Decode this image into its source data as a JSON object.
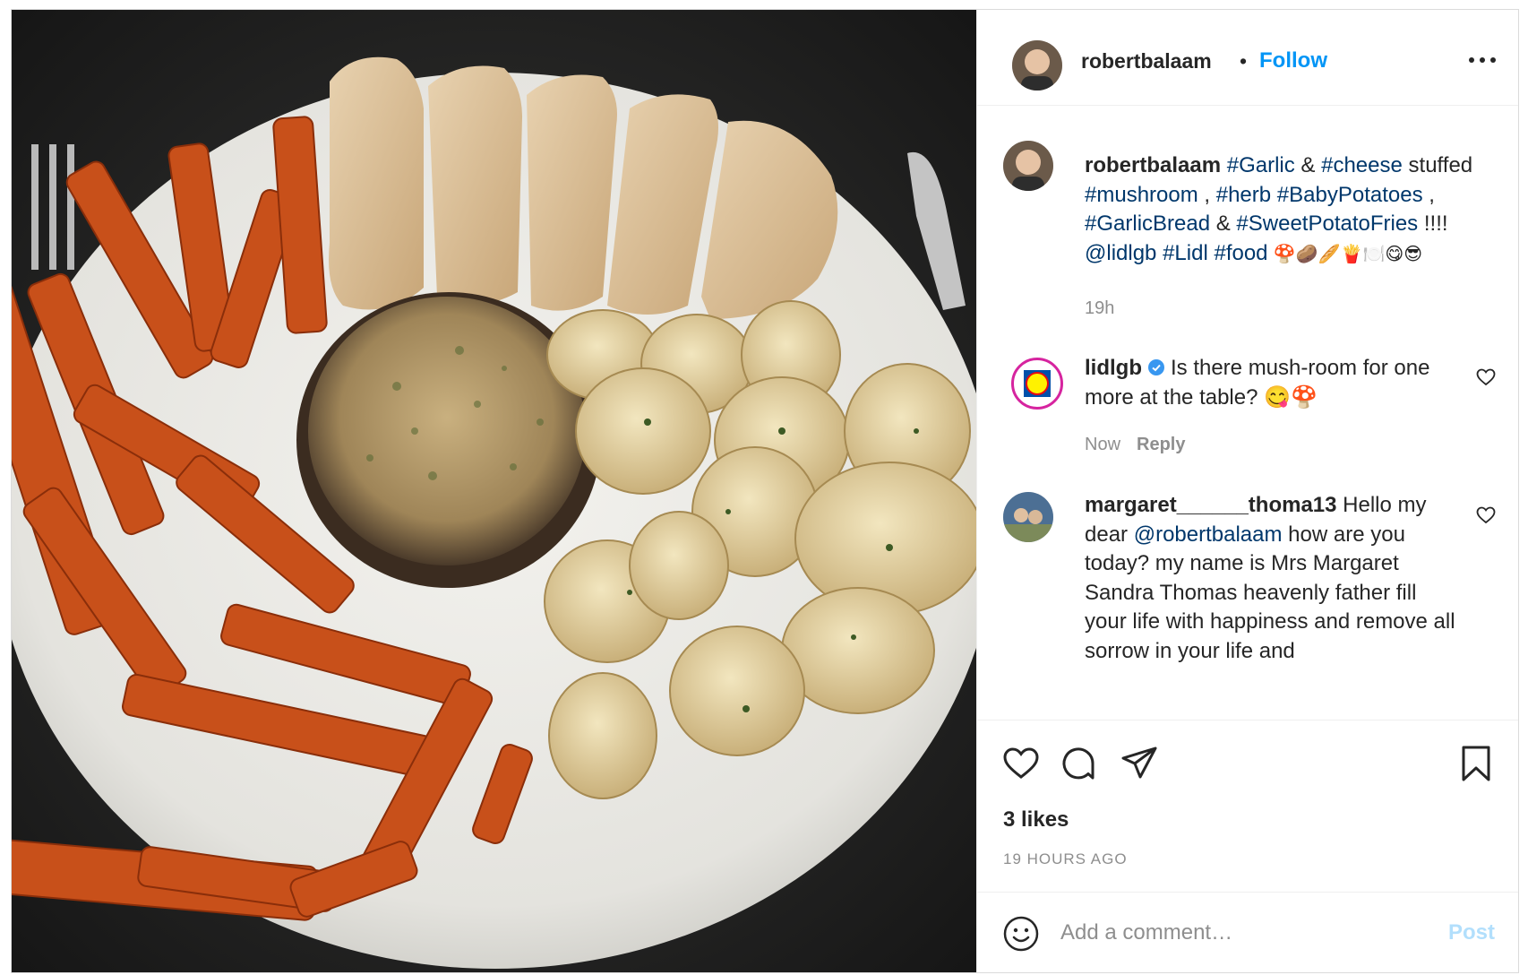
{
  "post": {
    "username": "robertbalaam",
    "dot": "•",
    "follow_label": "Follow",
    "more_icon": "more-horizontal-icon",
    "image_alt": "Plate of food with garlic bread, stuffed mushroom, baby potatoes and sweet potato fries"
  },
  "caption": {
    "username": "robertbalaam",
    "segments": [
      {
        "text": "#Garlic",
        "type": "tag"
      },
      {
        "text": " & ",
        "type": "text"
      },
      {
        "text": "#cheese",
        "type": "tag"
      },
      {
        "text": " stuffed ",
        "type": "text"
      },
      {
        "text": "#mushroom",
        "type": "tag"
      },
      {
        "text": " , ",
        "type": "text"
      },
      {
        "text": "#herb",
        "type": "tag"
      },
      {
        "text": " ",
        "type": "text"
      },
      {
        "text": "#BabyPotatoes",
        "type": "tag"
      },
      {
        "text": " , ",
        "type": "text"
      },
      {
        "text": "#GarlicBread",
        "type": "tag"
      },
      {
        "text": " & ",
        "type": "text"
      },
      {
        "text": "#SweetPotatoFries",
        "type": "tag"
      },
      {
        "text": " !!!! ",
        "type": "text"
      },
      {
        "text": "@lidlgb",
        "type": "tag"
      },
      {
        "text": " ",
        "type": "text"
      },
      {
        "text": "#Lidl",
        "type": "tag"
      },
      {
        "text": " ",
        "type": "text"
      },
      {
        "text": "#food",
        "type": "tag"
      },
      {
        "text": " 🍄🥔🥖🍟🍽️😋😎",
        "type": "emoji"
      }
    ],
    "time": "19h"
  },
  "comments": [
    {
      "username": "lidlgb",
      "verified": true,
      "text": "Is there mush-room for one more at the table? 😋🍄",
      "time": "Now",
      "reply_label": "Reply"
    },
    {
      "username": "margaret______thoma13",
      "mention": "@robertbalaam",
      "text_before": "Hello my dear",
      "text_after": "how are you today? my name is Mrs Margaret Sandra Thomas heavenly father fill your life with happiness and remove all sorrow in your life and"
    }
  ],
  "actions": {
    "like_icon": "heart-icon",
    "comment_icon": "comment-icon",
    "share_icon": "share-icon",
    "save_icon": "bookmark-icon"
  },
  "likes": "3 likes",
  "posted_ago": "19 HOURS AGO",
  "add_comment": {
    "placeholder": "Add a comment…",
    "post_label": "Post",
    "emoji_icon": "emoji-smiley-icon"
  },
  "colors": {
    "link_blue": "#0095f6",
    "tag_blue": "#00376b",
    "post_disabled": "#b2dffc",
    "muted": "#8e8e8e",
    "verified_blue": "#3897f0"
  }
}
